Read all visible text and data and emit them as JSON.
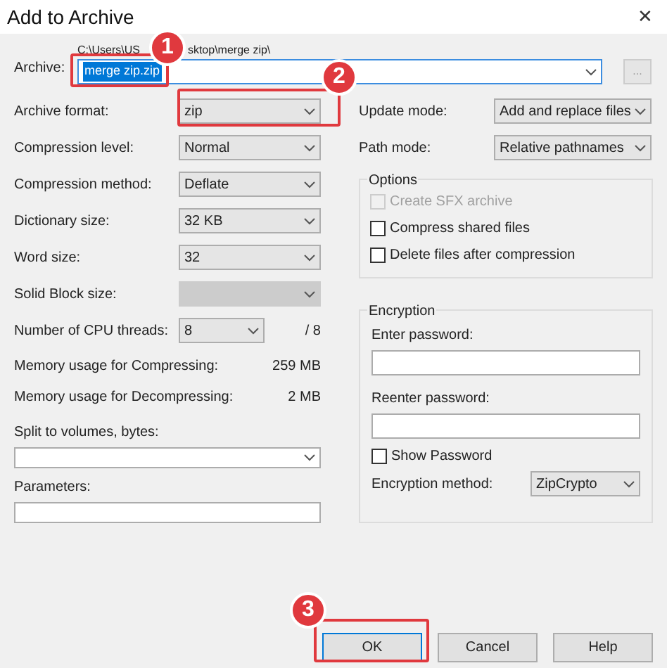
{
  "window": {
    "title": "Add to Archive",
    "close": "✕"
  },
  "archive": {
    "label": "Archive:",
    "path_parts": [
      "C:\\Users\\US",
      "sktop\\merge zip\\"
    ],
    "value": "merge zip.zip",
    "value_selected": true,
    "browse": "..."
  },
  "left_rows": [
    {
      "kind": "select",
      "label": "Archive format:",
      "value": "zip",
      "disabled": false
    },
    {
      "kind": "select",
      "label": "Compression level:",
      "value": "Normal",
      "disabled": false
    },
    {
      "kind": "select",
      "label": "Compression method:",
      "value": "Deflate",
      "disabled": false
    },
    {
      "kind": "select",
      "label": "Dictionary size:",
      "value": "32 KB",
      "disabled": false
    },
    {
      "kind": "select",
      "label": "Word size:",
      "value": "32",
      "disabled": false
    },
    {
      "kind": "select",
      "label": "Solid Block size:",
      "disabled": true
    },
    {
      "kind": "threads",
      "label": "Number of CPU threads:",
      "value": "8",
      "suffix": "/ 8",
      "disabled": false
    },
    {
      "kind": "memory",
      "label": "Memory usage for Compressing:",
      "value": "259 MB"
    },
    {
      "kind": "memory",
      "label": "Memory usage for Decompressing:",
      "value": "2 MB"
    }
  ],
  "split": {
    "label": "Split to volumes, bytes:"
  },
  "parameters": {
    "label": "Parameters:"
  },
  "right_rows": [
    {
      "label": "Update mode:",
      "value": "Add and replace files"
    },
    {
      "label": "Path mode:",
      "value": "Relative pathnames"
    }
  ],
  "options": {
    "title": "Options",
    "items": [
      {
        "label": "Create SFX archive",
        "checked": false,
        "disabled": true
      },
      {
        "label": "Compress shared files",
        "checked": false,
        "disabled": false
      },
      {
        "label": "Delete files after compression",
        "checked": false,
        "disabled": false
      }
    ]
  },
  "encryption": {
    "title": "Encryption",
    "enter_label": "Enter password:",
    "reenter_label": "Reenter password:",
    "show_password": {
      "label": "Show Password",
      "checked": false
    },
    "method_label": "Encryption method:",
    "method_value": "ZipCrypto"
  },
  "buttons": [
    {
      "label": "OK",
      "focused": true
    },
    {
      "label": "Cancel",
      "focused": false
    },
    {
      "label": "Help",
      "focused": false
    }
  ],
  "annotations": [
    {
      "label": "1"
    },
    {
      "label": "2"
    },
    {
      "label": "3"
    }
  ]
}
